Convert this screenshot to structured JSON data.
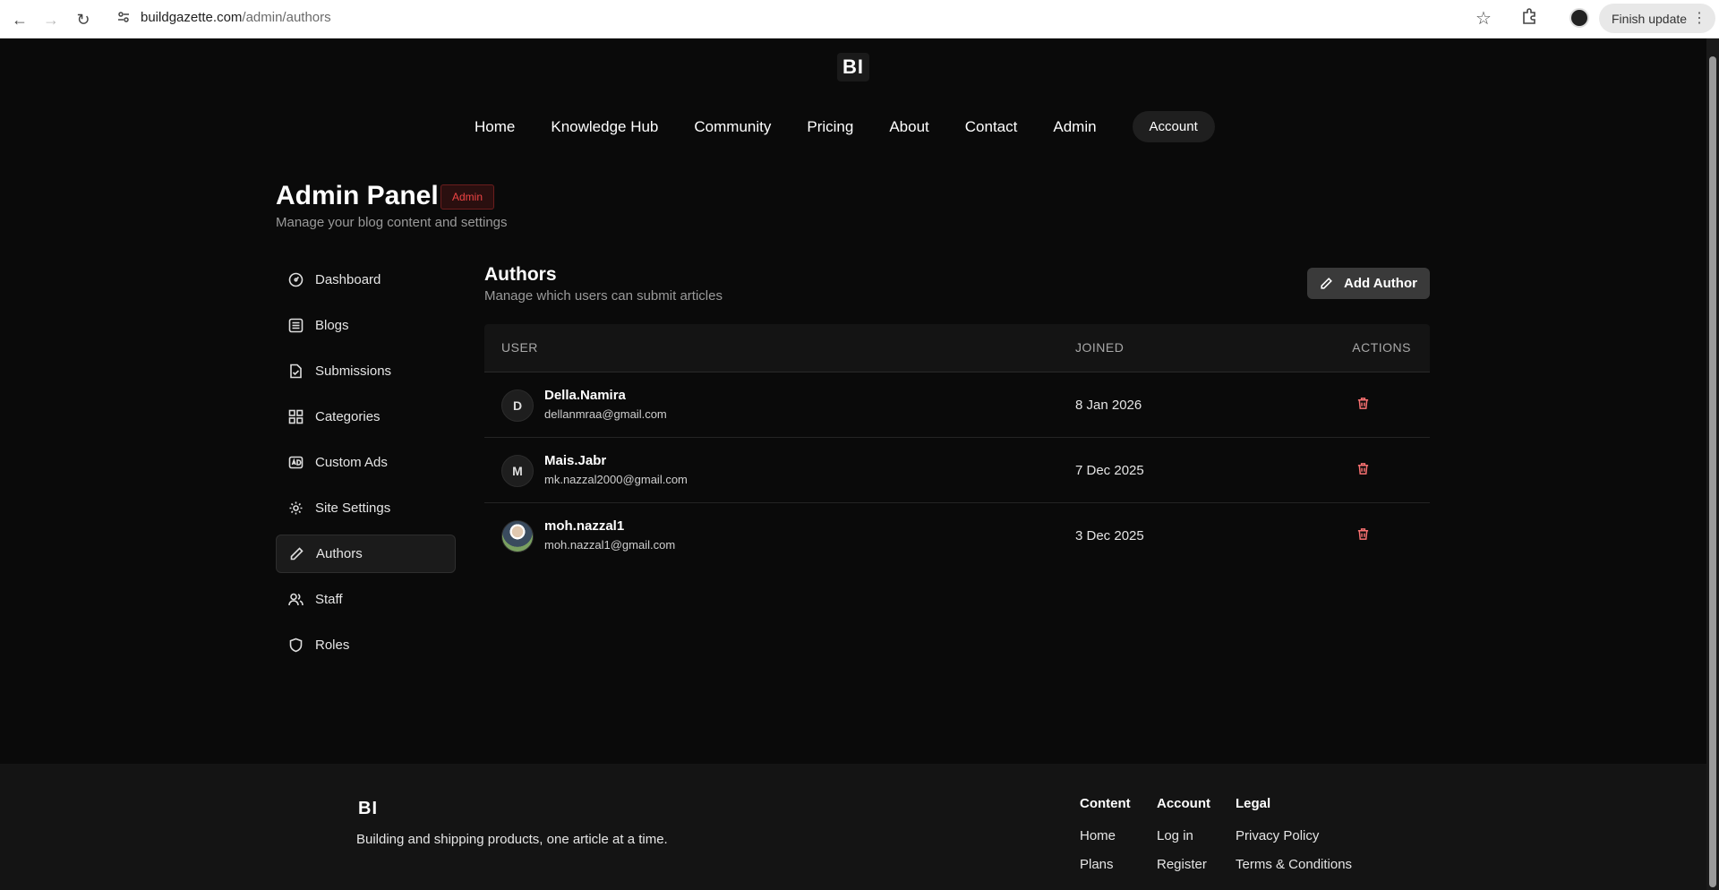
{
  "browser": {
    "url_host": "buildgazette.com",
    "url_path": "/admin/authors",
    "finish_update": "Finish update"
  },
  "site": {
    "logo": "BI",
    "nav": [
      "Home",
      "Knowledge Hub",
      "Community",
      "Pricing",
      "About",
      "Contact",
      "Admin"
    ],
    "account": "Account"
  },
  "admin": {
    "title": "Admin Panel",
    "badge": "Admin",
    "subtitle": "Manage your blog content and settings"
  },
  "sidebar": {
    "items": [
      {
        "label": "Dashboard",
        "icon": "dashboard-icon"
      },
      {
        "label": "Blogs",
        "icon": "list-icon"
      },
      {
        "label": "Submissions",
        "icon": "file-check-icon"
      },
      {
        "label": "Categories",
        "icon": "grid-icon"
      },
      {
        "label": "Custom Ads",
        "icon": "ad-icon"
      },
      {
        "label": "Site Settings",
        "icon": "gear-icon"
      },
      {
        "label": "Authors",
        "icon": "pencil-icon",
        "active": true
      },
      {
        "label": "Staff",
        "icon": "users-icon"
      },
      {
        "label": "Roles",
        "icon": "shield-icon"
      }
    ]
  },
  "authors": {
    "title": "Authors",
    "subtitle": "Manage which users can submit articles",
    "add_label": "Add Author",
    "columns": {
      "user": "USER",
      "joined": "JOINED",
      "actions": "ACTIONS"
    },
    "rows": [
      {
        "initial": "D",
        "name": "Della.Namira",
        "email": "dellanmraa@gmail.com",
        "joined": "8 Jan 2026"
      },
      {
        "initial": "M",
        "name": "Mais.Jabr",
        "email": "mk.nazzal2000@gmail.com",
        "joined": "7 Dec 2025"
      },
      {
        "initial": "",
        "name": "moh.nazzal1",
        "email": "moh.nazzal1@gmail.com",
        "joined": "3 Dec 2025"
      }
    ]
  },
  "footer": {
    "logo": "BI",
    "tagline": "Building and shipping products, one article at a time.",
    "columns": [
      {
        "heading": "Content",
        "links": [
          "Home",
          "Plans"
        ]
      },
      {
        "heading": "Account",
        "links": [
          "Log in",
          "Register"
        ]
      },
      {
        "heading": "Legal",
        "links": [
          "Privacy Policy",
          "Terms & Conditions"
        ]
      }
    ]
  },
  "colors": {
    "accent_danger": "#ef4444",
    "background": "#0a0a0a"
  }
}
